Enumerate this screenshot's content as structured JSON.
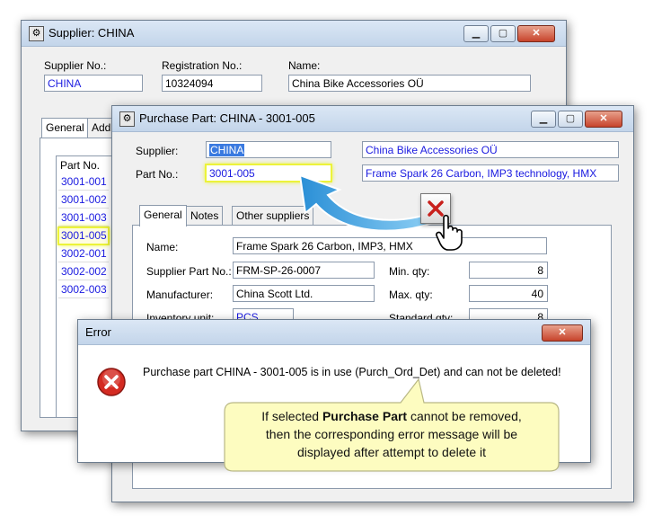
{
  "supplier_window": {
    "title": "Supplier: CHINA",
    "supplier_no_label": "Supplier No.:",
    "supplier_no": "CHINA",
    "registration_no_label": "Registration No.:",
    "registration_no": "10324094",
    "name_label": "Name:",
    "name": "China Bike Accessories OÜ",
    "tabs": [
      "General",
      "Add"
    ],
    "part_list": {
      "header": "Part No.",
      "rows": [
        "3001-001",
        "3001-002",
        "3001-003",
        "3001-005",
        "3002-001",
        "3002-002",
        "3002-003"
      ]
    }
  },
  "purchase_part_window": {
    "title": "Purchase Part: CHINA - 3001-005",
    "supplier_label": "Supplier:",
    "supplier": "CHINA",
    "supplier_name": "China Bike Accessories OÜ",
    "part_no_label": "Part No.:",
    "part_no": "3001-005",
    "part_desc": "Frame Spark 26 Carbon, IMP3 technology, HMX",
    "tabs": [
      "General",
      "Notes",
      "Other suppliers"
    ],
    "name_label": "Name:",
    "name": "Frame Spark 26 Carbon, IMP3, HMX",
    "supplier_part_no_label": "Supplier Part No.:",
    "supplier_part_no": "FRM-SP-26-0007",
    "min_qty_label": "Min. qty:",
    "min_qty": "8",
    "manufacturer_label": "Manufacturer:",
    "manufacturer": "China Scott Ltd.",
    "max_qty_label": "Max. qty:",
    "max_qty": "40",
    "inventory_unit_label": "Inventory unit:",
    "inventory_unit": "PCS",
    "standard_qty_label": "Standard qty:",
    "standard_qty": "8"
  },
  "error_dialog": {
    "title": "Error",
    "message": "Purchase part CHINA - 3001-005 is in use (Purch_Ord_Det) and can not be deleted!"
  },
  "callout": {
    "line1_prefix": "If selected ",
    "line1_bold": "Purchase Part",
    "line1_suffix": " cannot be removed,",
    "line2": "then the corresponding error message will be",
    "line3": "displayed after attempt to delete it"
  },
  "colors": {
    "link_blue": "#1a1ae0",
    "highlight_yellow": "#ecf33a",
    "callout_fill": "#fdfcc0",
    "arrow_blue": "#4aa8e0",
    "error_red": "#c8201c"
  }
}
